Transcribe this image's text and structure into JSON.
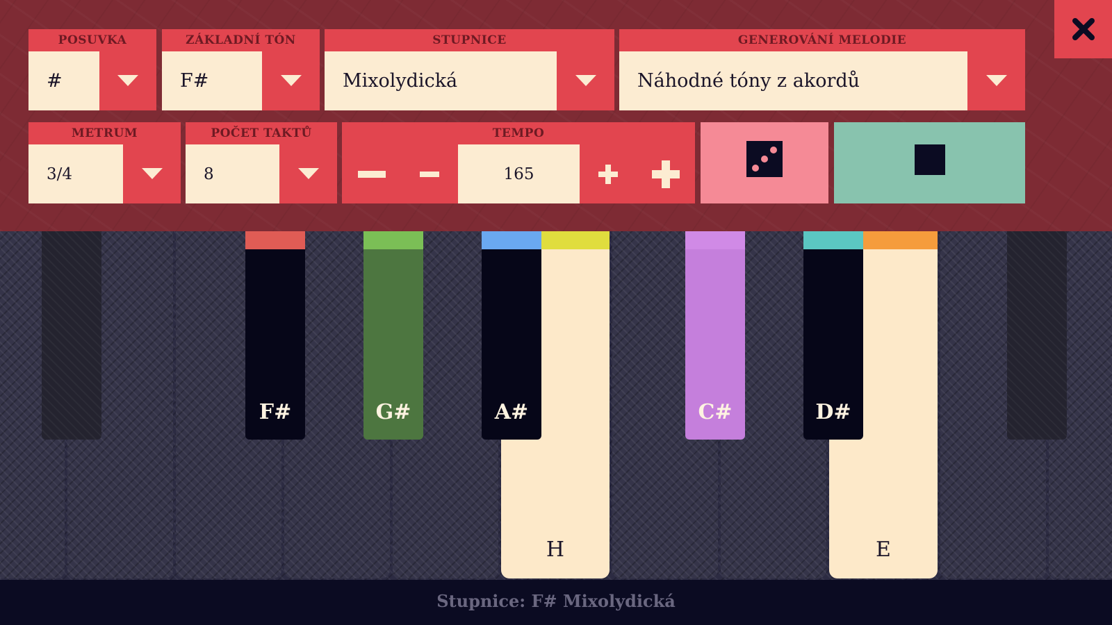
{
  "controls": {
    "posuvka": {
      "label": "POSUVKA",
      "value": "#"
    },
    "zakladni_ton": {
      "label": "ZÁKLADNÍ TÓN",
      "value": "F#"
    },
    "stupnice": {
      "label": "STUPNICE",
      "value": "Mixolydická"
    },
    "generovani": {
      "label": "GENEROVÁNÍ MELODIE",
      "value": "Náhodné tóny z akordů"
    },
    "metrum": {
      "label": "METRUM",
      "value": "3/4"
    },
    "pocet_taktu": {
      "label": "POČET TAKTŮ",
      "value": "8"
    },
    "tempo": {
      "label": "TEMPO",
      "value": "165"
    }
  },
  "keys": {
    "fsharp": {
      "name": "F#",
      "color": "#e05c55"
    },
    "gsharp": {
      "name": "G#",
      "color": "#7bbf56",
      "fill": "#4d7640"
    },
    "asharp": {
      "name": "A#",
      "color": "#6aa8f0"
    },
    "h": {
      "name": "H",
      "color": "#e0dd3e"
    },
    "csharp": {
      "name": "C#",
      "color": "#d08ae6",
      "fill": "#c57fdc"
    },
    "dsharp": {
      "name": "D#",
      "color": "#5bc7c2"
    },
    "e": {
      "name": "E",
      "color": "#f59c3c"
    }
  },
  "footer": {
    "text": "Stupnice: F# Mixolydická"
  },
  "icons": {
    "dice": "dice-icon",
    "stop": "stop-icon",
    "close": "close-icon"
  }
}
